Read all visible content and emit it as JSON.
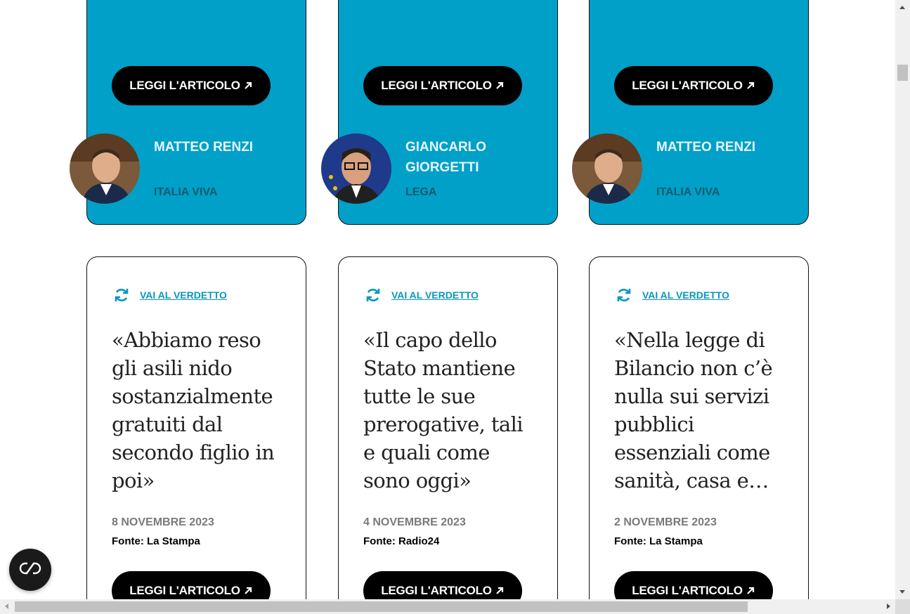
{
  "colors": {
    "card_blue": "#00a0c8",
    "link": "#0897bd",
    "button": "#000000"
  },
  "button_label": "LEGGI L'ARTICOLO",
  "verdict_label": "VAI AL VERDETTO",
  "top_cards": [
    {
      "name": "MATTEO RENZI",
      "party": "ITALIA VIVA",
      "avatar": "matteo-renzi-avatar"
    },
    {
      "name": "GIANCARLO GIORGETTI",
      "party": "LEGA",
      "avatar": "giancarlo-giorgetti-avatar"
    },
    {
      "name": "MATTEO RENZI",
      "party": "ITALIA VIVA",
      "avatar": "matteo-renzi-avatar"
    }
  ],
  "bottom_cards": [
    {
      "quote": "«Abbiamo reso gli asili nido sostanzialmente gratuiti dal secondo figlio in poi»",
      "date": "8 NOVEMBRE 2023",
      "source": "Fonte: La Stampa"
    },
    {
      "quote": "«Il capo dello Stato mantiene tutte le sue prerogative, tali e quali come sono oggi»",
      "date": "4 NOVEMBRE 2023",
      "source": "Fonte: Radio24"
    },
    {
      "quote": "«Nella legge di Bilancio non c’è nulla sui servizi pubblici essenziali come sanità, casa e…",
      "date": "2 NOVEMBRE 2023",
      "source": "Fonte: La Stampa"
    }
  ],
  "icons": {
    "arrow": "arrow-up-right-icon",
    "verdict": "refresh-icon",
    "floating": "accessibility-toggle-icon"
  }
}
